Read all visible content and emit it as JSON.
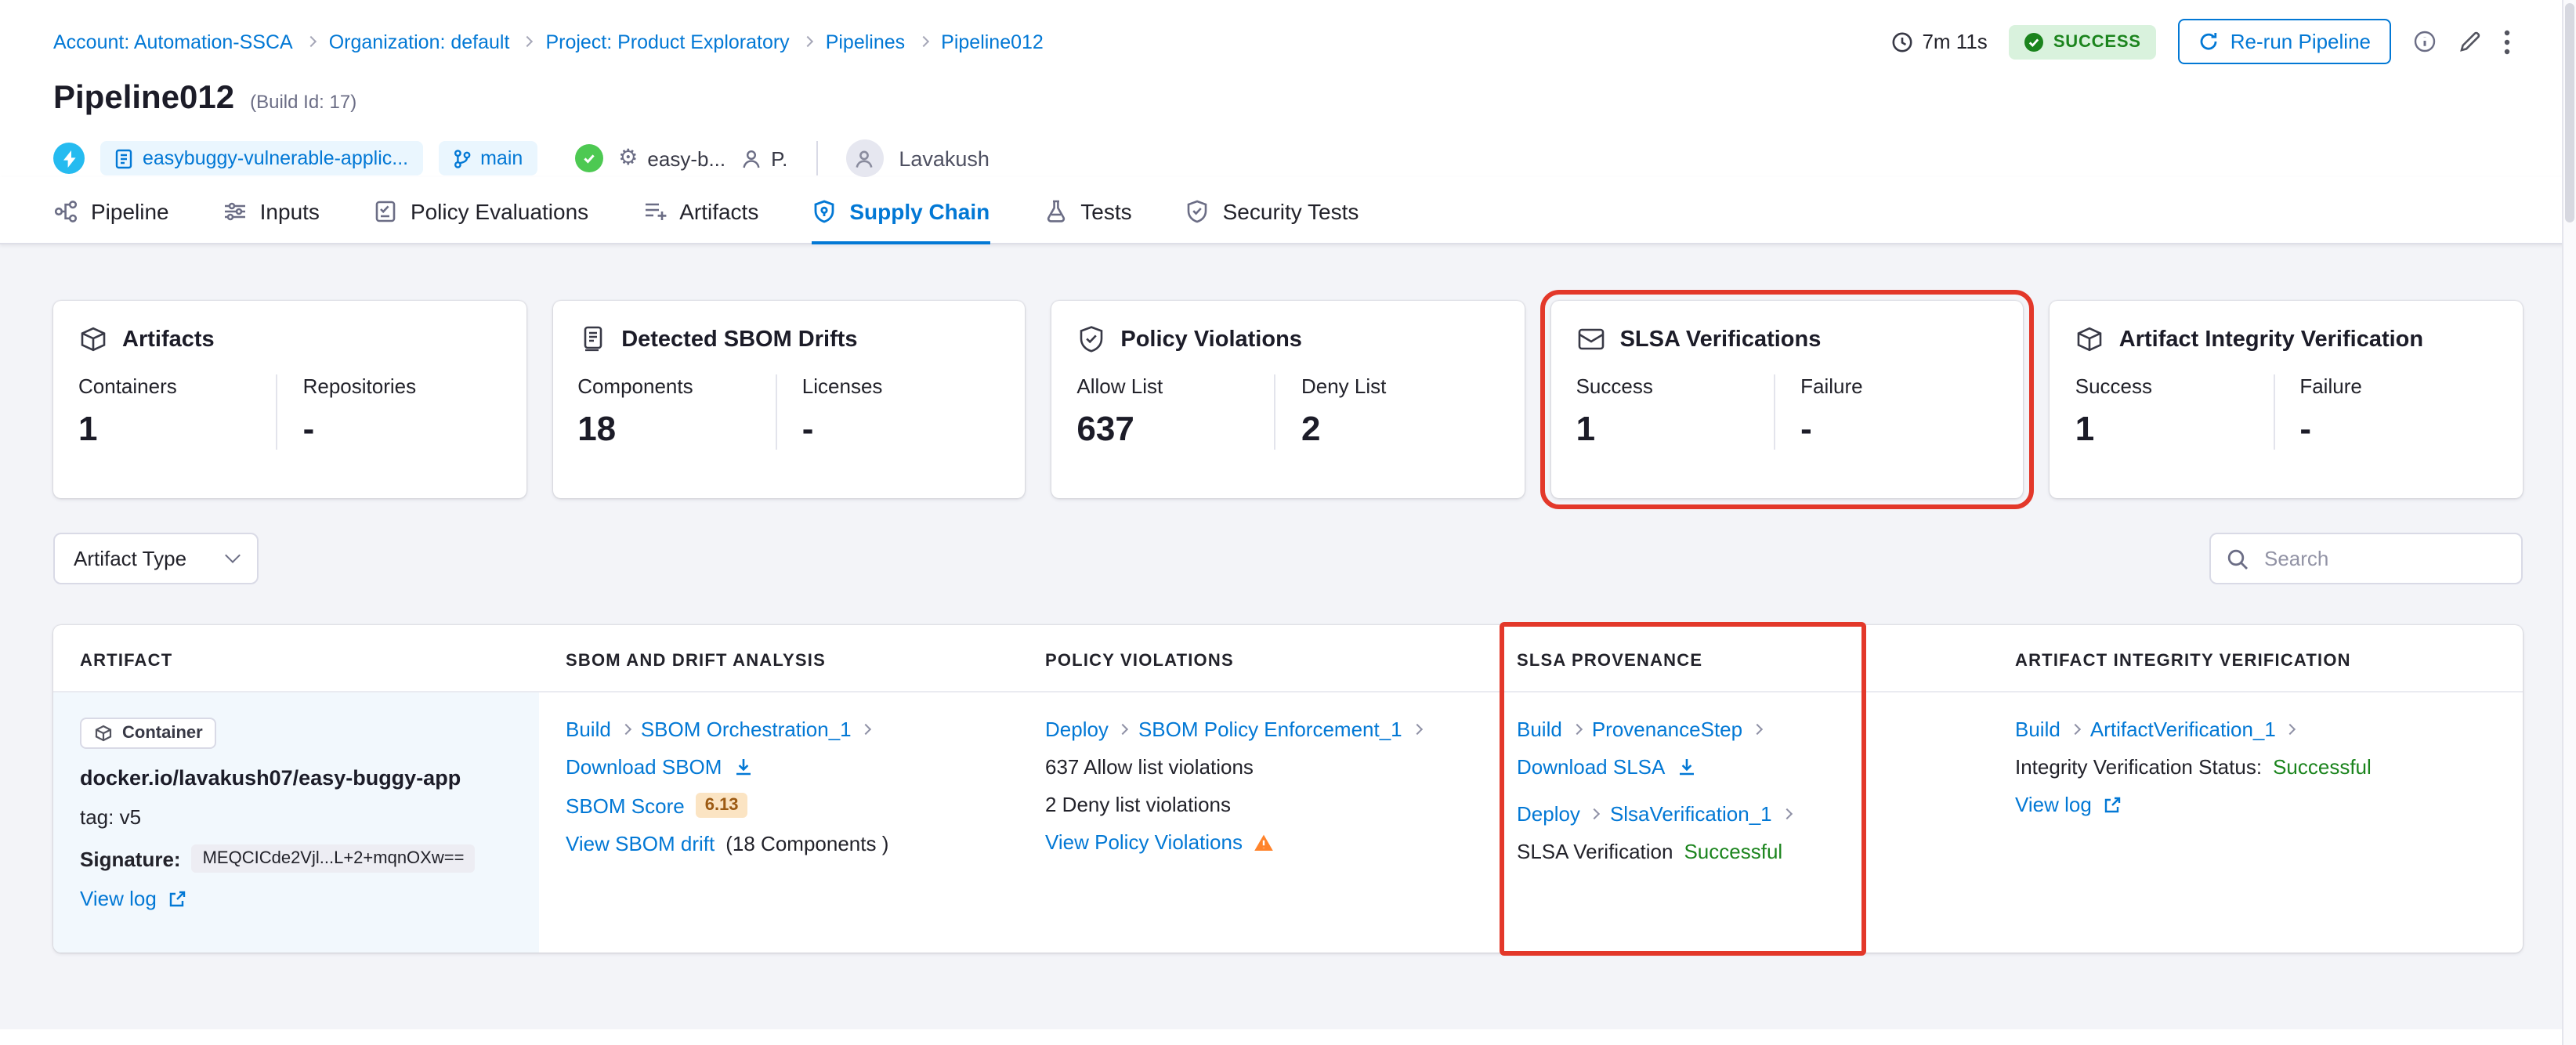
{
  "colors": {
    "accent_blue": "#0278D5",
    "success_green": "#1B841D",
    "success_badge_bg": "#D9F2DD",
    "highlight_red": "#E3382A",
    "warning_orange": "#FF832B",
    "score_badge_bg": "#FBE4C3",
    "score_badge_text": "#9C5A13",
    "page_bg": "#F3F4F8"
  },
  "icons": {
    "gear": "⚙"
  },
  "breadcrumb": {
    "items": [
      {
        "label": "Account: Automation-SSCA"
      },
      {
        "label": "Organization: default"
      },
      {
        "label": "Project: Product Exploratory"
      },
      {
        "label": "Pipelines"
      },
      {
        "label": "Pipeline012"
      }
    ]
  },
  "topbar": {
    "duration": "7m 11s",
    "status": "SUCCESS",
    "rerun_button": "Re-run Pipeline"
  },
  "header": {
    "title": "Pipeline012",
    "build_id": "(Build Id: 17)",
    "repo_name": "easybuggy-vulnerable-applic...",
    "branch": "main",
    "service": "easy-b...",
    "environment": "P.",
    "user": "Lavakush"
  },
  "tabs": [
    {
      "label": "Pipeline"
    },
    {
      "label": "Inputs"
    },
    {
      "label": "Policy Evaluations"
    },
    {
      "label": "Artifacts"
    },
    {
      "label": "Supply Chain"
    },
    {
      "label": "Tests"
    },
    {
      "label": "Security Tests"
    }
  ],
  "summary_cards": [
    {
      "title": "Artifacts",
      "stats": [
        {
          "label": "Containers",
          "value": "1"
        },
        {
          "label": "Repositories",
          "value": "-"
        }
      ]
    },
    {
      "title": "Detected SBOM Drifts",
      "stats": [
        {
          "label": "Components",
          "value": "18"
        },
        {
          "label": "Licenses",
          "value": "-"
        }
      ]
    },
    {
      "title": "Policy Violations",
      "stats": [
        {
          "label": "Allow List",
          "value": "637"
        },
        {
          "label": "Deny List",
          "value": "2"
        }
      ]
    },
    {
      "title": "SLSA Verifications",
      "stats": [
        {
          "label": "Success",
          "value": "1"
        },
        {
          "label": "Failure",
          "value": "-"
        }
      ]
    },
    {
      "title": "Artifact Integrity Verification",
      "stats": [
        {
          "label": "Success",
          "value": "1"
        },
        {
          "label": "Failure",
          "value": "-"
        }
      ]
    }
  ],
  "filters": {
    "artifact_type_label": "Artifact Type",
    "search_placeholder": "Search"
  },
  "table": {
    "columns": [
      "ARTIFACT",
      "SBOM AND DRIFT ANALYSIS",
      "POLICY VIOLATIONS",
      "SLSA PROVENANCE",
      "ARTIFACT INTEGRITY VERIFICATION"
    ],
    "row": {
      "artifact": {
        "type": "Container",
        "image": "docker.io/lavakush07/easy-buggy-app",
        "tag": "tag: v5",
        "signature_label": "Signature:",
        "signature_value": "MEQCICde2Vjl...L+2+mqnOXw==",
        "view_log": "View log"
      },
      "sbom": {
        "stage": "Build",
        "step": "SBOM Orchestration_1",
        "download": "Download SBOM",
        "score_label": "SBOM Score",
        "score_value": "6.13",
        "drift_link": "View SBOM drift",
        "drift_note": "(18 Components )"
      },
      "policy": {
        "stage": "Deploy",
        "step": "SBOM Policy Enforcement_1",
        "allow_text": "637 Allow list violations",
        "deny_text": "2 Deny list violations",
        "view_link": "View Policy Violations"
      },
      "slsa": {
        "stage1": "Build",
        "step1": "ProvenanceStep",
        "download": "Download SLSA",
        "stage2": "Deploy",
        "step2": "SlsaVerification_1",
        "status_label": "SLSA Verification",
        "status_value": "Successful"
      },
      "integrity": {
        "stage": "Build",
        "step": "ArtifactVerification_1",
        "status_label": "Integrity Verification Status:",
        "status_value": "Successful",
        "view_log": "View log"
      }
    }
  }
}
